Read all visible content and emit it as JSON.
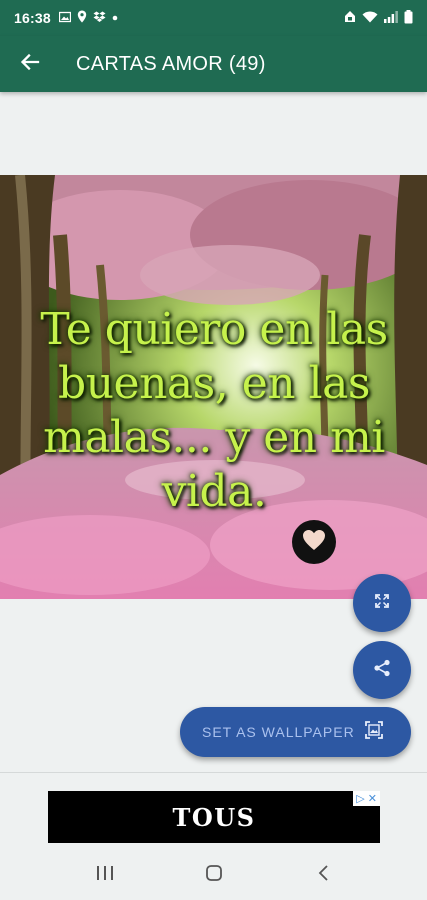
{
  "status_bar": {
    "time": "16:38",
    "left_icons": [
      "image-icon",
      "location-icon",
      "dropbox-icon",
      "dot-icon"
    ],
    "right_icons": [
      "lock-icon",
      "wifi-icon",
      "signal-icon",
      "battery-icon"
    ]
  },
  "app_bar": {
    "title": "CARTAS AMOR (49)",
    "back_icon": "arrow-left-icon"
  },
  "card": {
    "quote": "Te quiero en las buenas, en las malas... y en mi vida."
  },
  "actions": {
    "favorite_icon": "heart-icon",
    "expand_icon": "expand-icon",
    "share_icon": "share-icon",
    "wallpaper_label": "SET AS WALLPAPER",
    "wallpaper_icon": "wallpaper-icon"
  },
  "ad": {
    "brand": "TOUS",
    "adchoices": "▷ ✕"
  },
  "colors": {
    "primary": "#1f6b52",
    "fab": "#2d58a3",
    "background": "#eef1f1",
    "quote_text": "#c6f24c"
  }
}
